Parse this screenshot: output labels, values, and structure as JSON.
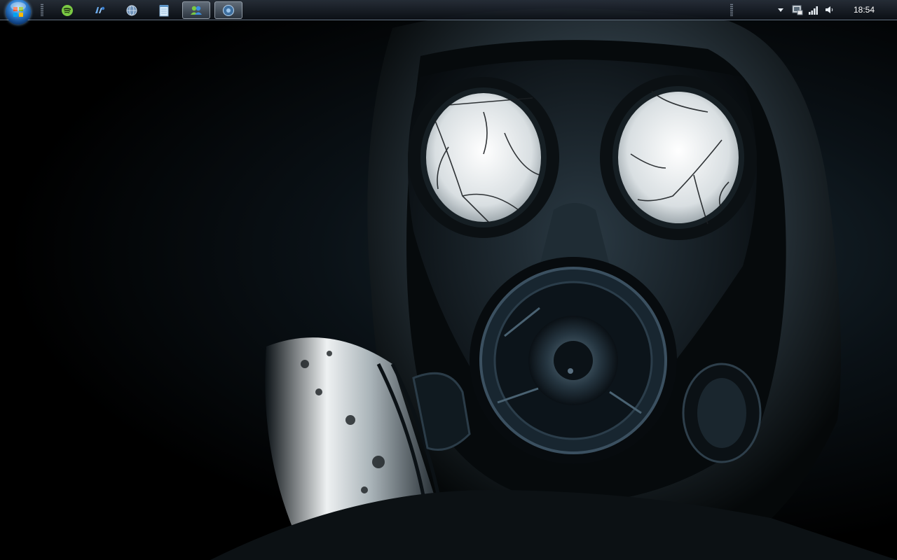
{
  "taskbar": {
    "pinned": [
      {
        "name": "spotify",
        "icon": "spotify-icon",
        "active": false
      },
      {
        "name": "messenger",
        "icon": "messenger-icon",
        "active": false
      },
      {
        "name": "browser",
        "icon": "globe-icon",
        "active": false
      },
      {
        "name": "notepad",
        "icon": "notepad-icon",
        "active": false
      },
      {
        "name": "windows-live-messenger",
        "icon": "buddy-icon",
        "active": true
      },
      {
        "name": "media-player",
        "icon": "media-icon",
        "active": true
      }
    ],
    "tray": {
      "icons": [
        "show-hidden-icons-arrow-icon",
        "network-monitor-icon",
        "signal-bars-icon",
        "volume-icon"
      ],
      "clock": "18:54"
    }
  },
  "colors": {
    "accent": "#2f7fd1",
    "spotify_green": "#7ac943",
    "taskbar_border": "#98aabe"
  }
}
